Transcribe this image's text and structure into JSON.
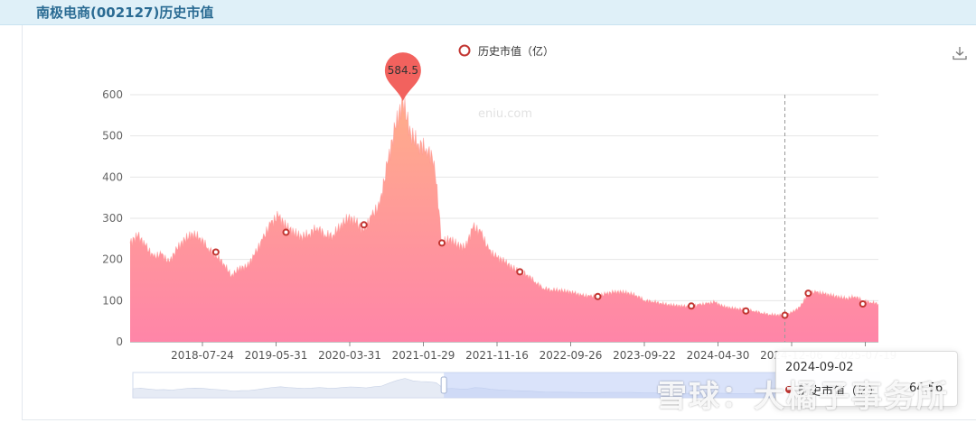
{
  "header": {
    "title": "南极电商(002127)历史市值"
  },
  "download_icon": "download-icon",
  "tooltip": {
    "date": "2024-09-02",
    "series_name": "历史市值（亿）",
    "value": "64.56"
  },
  "watermark": {
    "text": "雪球：大橘子事务所"
  },
  "chart_data": {
    "type": "area",
    "title": "",
    "xlabel": "",
    "ylabel": "",
    "legend": {
      "entries": [
        "历史市值（亿）"
      ],
      "position": "top-center"
    },
    "watermark_text": "eniu.com",
    "ylim": [
      0,
      600
    ],
    "y_ticks": [
      0,
      100,
      200,
      300,
      400,
      500,
      600
    ],
    "x_tick_labels": [
      "2018-07-24",
      "2019-05-31",
      "2020-03-31",
      "2021-01-29",
      "2021-11-16",
      "2022-09-26",
      "2023-09-22",
      "2024-04-30",
      "2024-12-06",
      "2025-07-19"
    ],
    "grid": true,
    "max_marker": {
      "label": "584.5",
      "date": "2020-08",
      "value": 584.5
    },
    "series": [
      {
        "name": "历史市值（亿）",
        "color": "#c23531",
        "area_gradient": [
          "#ffae8a",
          "#ff85a8"
        ],
        "points": [
          [
            "2017-09",
            240
          ],
          [
            "2017-10",
            258
          ],
          [
            "2017-11",
            232
          ],
          [
            "2017-12",
            205
          ],
          [
            "2018-01",
            212
          ],
          [
            "2018-02",
            192
          ],
          [
            "2018-03",
            225
          ],
          [
            "2018-04",
            248
          ],
          [
            "2018-05",
            262
          ],
          [
            "2018-06",
            252
          ],
          [
            "2018-07",
            228
          ],
          [
            "2018-08",
            210
          ],
          [
            "2018-09",
            190
          ],
          [
            "2018-10",
            160
          ],
          [
            "2018-11",
            178
          ],
          [
            "2018-12",
            182
          ],
          [
            "2019-01",
            212
          ],
          [
            "2019-02",
            248
          ],
          [
            "2019-03",
            285
          ],
          [
            "2019-04",
            305
          ],
          [
            "2019-05",
            280
          ],
          [
            "2019-06",
            265
          ],
          [
            "2019-07",
            255
          ],
          [
            "2019-08",
            262
          ],
          [
            "2019-09",
            278
          ],
          [
            "2019-10",
            260
          ],
          [
            "2019-11",
            258
          ],
          [
            "2019-12",
            282
          ],
          [
            "2020-01",
            300
          ],
          [
            "2020-02",
            290
          ],
          [
            "2020-03",
            268
          ],
          [
            "2020-04",
            305
          ],
          [
            "2020-05",
            330
          ],
          [
            "2020-06",
            430
          ],
          [
            "2020-07",
            520
          ],
          [
            "2020-08",
            584.5
          ],
          [
            "2020-09",
            505
          ],
          [
            "2020-10",
            480
          ],
          [
            "2020-11",
            470
          ],
          [
            "2020-12",
            440
          ],
          [
            "2021-01",
            240
          ],
          [
            "2021-02",
            250
          ],
          [
            "2021-03",
            235
          ],
          [
            "2021-04",
            228
          ],
          [
            "2021-05",
            278
          ],
          [
            "2021-06",
            265
          ],
          [
            "2021-07",
            222
          ],
          [
            "2021-08",
            205
          ],
          [
            "2021-09",
            195
          ],
          [
            "2021-10",
            180
          ],
          [
            "2021-11",
            170
          ],
          [
            "2021-12",
            162
          ],
          [
            "2022-01",
            145
          ],
          [
            "2022-02",
            130
          ],
          [
            "2022-03",
            126
          ],
          [
            "2022-04",
            125
          ],
          [
            "2022-05",
            122
          ],
          [
            "2022-06",
            118
          ],
          [
            "2022-07",
            112
          ],
          [
            "2022-08",
            110
          ],
          [
            "2022-09",
            110
          ],
          [
            "2022-10",
            116
          ],
          [
            "2022-11",
            120
          ],
          [
            "2022-12",
            121
          ],
          [
            "2023-01",
            118
          ],
          [
            "2023-02",
            112
          ],
          [
            "2023-03",
            100
          ],
          [
            "2023-04",
            98
          ],
          [
            "2023-05",
            94
          ],
          [
            "2023-06",
            90
          ],
          [
            "2023-07",
            88
          ],
          [
            "2023-08",
            86
          ],
          [
            "2023-09",
            85
          ],
          [
            "2023-10",
            90
          ],
          [
            "2023-11",
            92
          ],
          [
            "2023-12",
            96
          ],
          [
            "2024-01",
            86
          ],
          [
            "2024-02",
            82
          ],
          [
            "2024-03",
            80
          ],
          [
            "2024-04",
            78
          ],
          [
            "2024-05",
            75
          ],
          [
            "2024-06",
            70
          ],
          [
            "2024-07",
            66
          ],
          [
            "2024-08",
            65
          ],
          [
            "2024-09",
            64.56
          ],
          [
            "2024-10",
            72
          ],
          [
            "2024-11",
            85
          ],
          [
            "2024-12",
            118
          ],
          [
            "2025-01",
            120
          ],
          [
            "2025-02",
            116
          ],
          [
            "2025-03",
            112
          ],
          [
            "2025-04",
            108
          ],
          [
            "2025-05",
            105
          ],
          [
            "2025-06",
            110
          ],
          [
            "2025-07",
            100
          ],
          [
            "2025-08",
            96
          ],
          [
            "2025-09",
            92
          ]
        ]
      }
    ],
    "markers": [
      {
        "date": "2018-08",
        "value": 218
      },
      {
        "date": "2019-05",
        "value": 266
      },
      {
        "date": "2020-03",
        "value": 284
      },
      {
        "date": "2021-01",
        "value": 240
      },
      {
        "date": "2021-11",
        "value": 170
      },
      {
        "date": "2022-09",
        "value": 110
      },
      {
        "date": "2023-09",
        "value": 87
      },
      {
        "date": "2024-04",
        "value": 75
      },
      {
        "date": "2024-09",
        "value": 64.56
      },
      {
        "date": "2024-12",
        "value": 118
      },
      {
        "date": "2025-07",
        "value": 92
      }
    ],
    "crosshair_date": "2024-09",
    "data_zoom": {
      "start_date": "2021-01",
      "end_date": "2025-09"
    }
  }
}
